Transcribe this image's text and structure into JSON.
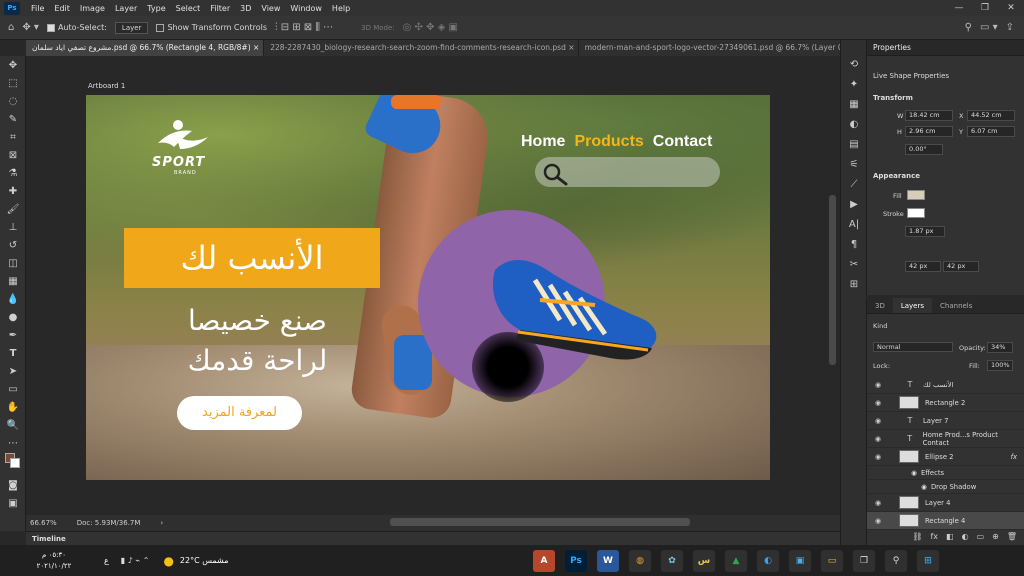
{
  "app": {
    "logo_text": "Ps"
  },
  "menu": [
    "File",
    "Edit",
    "Image",
    "Layer",
    "Type",
    "Select",
    "Filter",
    "3D",
    "View",
    "Window",
    "Help"
  ],
  "window_controls": {
    "minimize": "—",
    "maximize": "❐",
    "close": "✕"
  },
  "options_bar": {
    "auto_select_label": "Auto-Select:",
    "auto_select_value": "Layer",
    "transform_controls_label": "Show Transform Controls",
    "mode_3d_label": "3D Mode:"
  },
  "tabs": [
    {
      "label": "مشروع تصفي اياد سلمان.psd @ 66.7% (Rectangle 4, RGB/8#) ×"
    },
    {
      "label": "228-2287430_biology-research-search-zoom-find-comments-research-icon.psd ×"
    },
    {
      "label": "modern-man-and-sport-logo-vector-27349061.psd @ 66.7% (Layer 0, R..."
    }
  ],
  "artboard": {
    "label": "Artboard 1",
    "logo_sport": "SPORT",
    "logo_brand": "BRAND",
    "nav": {
      "home": "Home",
      "products": "Products",
      "contact": "Contact"
    },
    "headline": "الأنسب لك",
    "sub_line1": "صنع خصيصا",
    "sub_line2": "لراحة قدمك",
    "more_button": "لمعرفة المزيد"
  },
  "status": {
    "zoom": "66.67%",
    "doc": "Doc: 5.93M/36.7M"
  },
  "timeline_label": "Timeline",
  "properties": {
    "title": "Properties",
    "live_shape": "Live Shape Properties",
    "transform": "Transform",
    "w_label": "W",
    "w": "18.42 cm",
    "x_label": "X",
    "x": "44.52 cm",
    "h_label": "H",
    "h": "2.96 cm",
    "y_label": "Y",
    "y": "6.07 cm",
    "angle": "0.00°",
    "appearance": "Appearance",
    "fill_label": "Fill",
    "stroke_label": "Stroke",
    "stroke_width": "1.87 px",
    "radius1": "42 px",
    "radius2": "42 px"
  },
  "layers": {
    "tabs": [
      "3D",
      "Layers",
      "Channels"
    ],
    "filter": "Kind",
    "blend_mode": "Normal",
    "opacity_label": "Opacity:",
    "opacity": "34%",
    "lock_label": "Lock:",
    "fill_label": "Fill:",
    "fill": "100%",
    "items": [
      {
        "kind": "text",
        "name": "الأنسب لك"
      },
      {
        "kind": "shape",
        "name": "Rectangle 2"
      },
      {
        "kind": "text",
        "name": "Layer 7"
      },
      {
        "kind": "text",
        "name": "Home  Prod...s  Product  Contact"
      },
      {
        "kind": "shape",
        "name": "Ellipse 2"
      },
      {
        "kind": "effect",
        "name": "Effects"
      },
      {
        "kind": "effect",
        "name": "Drop Shadow"
      },
      {
        "kind": "image",
        "name": "Layer 4"
      },
      {
        "kind": "shape",
        "name": "Rectangle 4"
      }
    ]
  },
  "taskbar": {
    "time": "٠٥:٣٠ م",
    "date": "٢٠٢١/١٠/٢٢",
    "weather": "22°C  مشمس",
    "lang": "ع"
  },
  "colors": {
    "accent_yellow": "#f0a71a",
    "ellipse_purple": "#8f64a8",
    "ps_blue": "#31a8ff"
  }
}
